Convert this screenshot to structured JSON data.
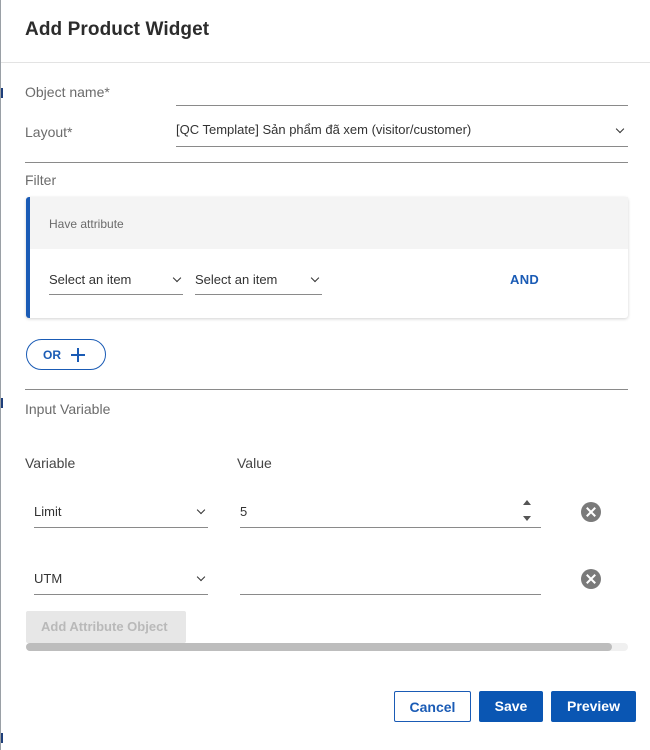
{
  "dialog": {
    "title": "Add Product Widget"
  },
  "form": {
    "object_name_label": "Object name*",
    "object_name_value": "",
    "layout_label": "Layout*",
    "layout_value": "[QC Template] Sản phẩm đã xem (visitor/customer)"
  },
  "filter": {
    "section_label": "Filter",
    "group_title": "Have attribute",
    "select_1": "Select an item",
    "select_2": "Select an item",
    "and_label": "AND",
    "or_label": "OR"
  },
  "input_variable": {
    "section_label": "Input Variable",
    "col_variable": "Variable",
    "col_value": "Value",
    "rows": [
      {
        "variable": "Limit",
        "value": "5"
      },
      {
        "variable": "UTM",
        "value": ""
      }
    ],
    "add_button": "Add Attribute Object"
  },
  "footer": {
    "cancel": "Cancel",
    "save": "Save",
    "preview": "Preview"
  },
  "colors": {
    "accent": "#1a5bb5",
    "primary_button": "#0a56b3",
    "remove_icon": "#7a7a7a"
  }
}
